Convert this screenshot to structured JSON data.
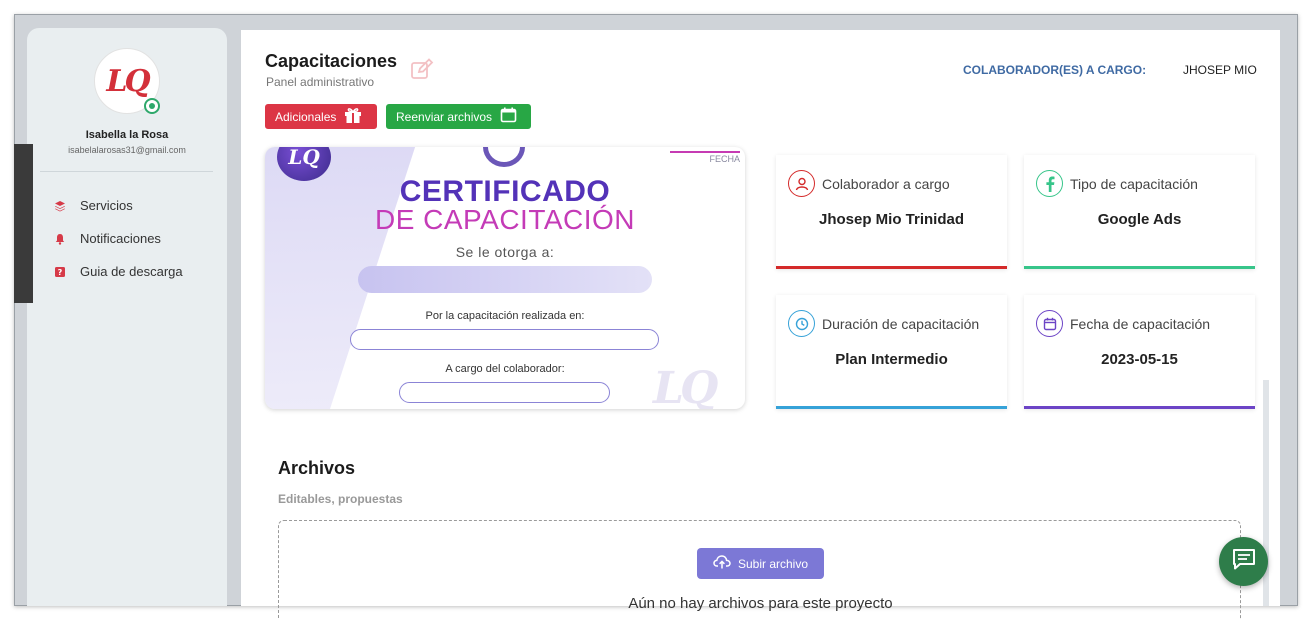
{
  "sidebar": {
    "user": {
      "name": "Isabella la Rosa",
      "email": "isabelalarosas31@gmail.com",
      "logo_text": "LQ",
      "status": "online"
    },
    "items": [
      {
        "label": "Servicios",
        "icon": "layers-icon"
      },
      {
        "label": "Notificaciones",
        "icon": "bell-icon"
      },
      {
        "label": "Guia de descarga",
        "icon": "help-icon"
      }
    ]
  },
  "header": {
    "title": "Capacitaciones",
    "subtitle": "Panel administrativo",
    "collaborator_label": "COLABORADOR(ES) A CARGO:",
    "collaborator_value": "JHOSEP MIO"
  },
  "actions": {
    "additional_label": "Adicionales",
    "resend_label": "Reenviar archivos"
  },
  "certificate": {
    "date_label": "FECHA",
    "title_line1": "CERTIFICADO",
    "title_line2": "DE CAPACITACIÓN",
    "granted_to": "Se le otorga a:",
    "training_label": "Por la capacitación realizada en:",
    "collaborator_label": "A cargo del colaborador:"
  },
  "cards": [
    {
      "label": "Colaborador a cargo",
      "value": "Jhosep Mio Trinidad",
      "icon": "user-icon",
      "color": "#d42a2a"
    },
    {
      "label": "Tipo de capacitación",
      "value": "Google Ads",
      "icon": "facebook-icon",
      "color": "#37c58a"
    },
    {
      "label": "Duración de capacitación",
      "value": "Plan Intermedio",
      "icon": "timer-icon",
      "color": "#36a2d8"
    },
    {
      "label": "Fecha de capacitación",
      "value": "2023-05-15",
      "icon": "calendar-icon",
      "color": "#6c44c6"
    }
  ],
  "files": {
    "title": "Archivos",
    "subtitle": "Editables, propuestas",
    "upload_label": "Subir archivo",
    "empty_message": "Aún no hay archivos para este proyecto"
  },
  "colors": {
    "danger": "#dc3545",
    "success": "#28a745",
    "upload": "#7c78d6",
    "chat": "#2e7d4a"
  }
}
